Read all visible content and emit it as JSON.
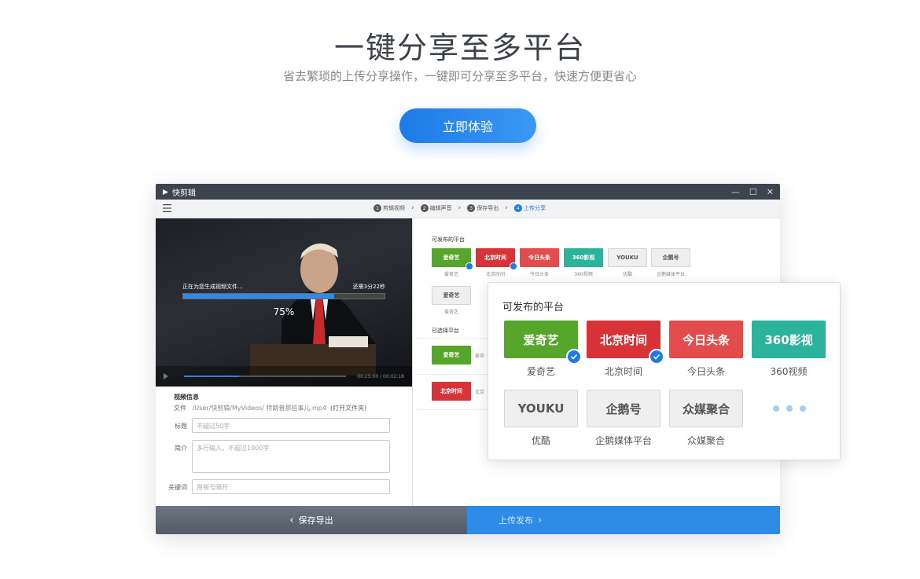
{
  "hero": {
    "title": "一键分享至多平台",
    "subtitle": "省去繁琐的上传分享操作，一键即可分享至多平台，快速方便更省心",
    "cta_label": "立即体验"
  },
  "window": {
    "app_name": "快剪辑",
    "controls": [
      "—",
      "☐",
      "✕"
    ]
  },
  "steps": [
    {
      "num": "1",
      "label": "剪辑视频",
      "active": false
    },
    {
      "num": "2",
      "label": "编辑声音",
      "active": false
    },
    {
      "num": "3",
      "label": "保存导出",
      "active": false
    },
    {
      "num": "4",
      "label": "上传分享",
      "active": true
    }
  ],
  "video": {
    "status_text": "正在为您生成视频文件...",
    "remaining_text": "还需3分22秒",
    "progress_percent": 75,
    "progress_label": "75%",
    "time": "00:25:00 / 00:02:18"
  },
  "form": {
    "heading": "视频信息",
    "file_label": "文件",
    "file_path": "/User/快剪辑/MyVideos/ 特朗普那些事儿.mp4",
    "open_folder": "(打开文件夹)",
    "title_label": "标题",
    "title_placeholder": "不超过50字",
    "intro_label": "简介",
    "intro_placeholder": "多行输入，不超过1000字",
    "keywords_label": "关键词",
    "keywords_placeholder": "用顿号隔开"
  },
  "right_panel": {
    "available_heading": "可发布的平台",
    "selected_heading": "已选择平台",
    "small_platforms": [
      {
        "logo": "爱奇艺",
        "label": "爱奇艺",
        "checked": true
      },
      {
        "logo": "北京时间",
        "label": "北京时间",
        "checked": true
      },
      {
        "logo": "今日头条",
        "label": "今日头条",
        "checked": false
      },
      {
        "logo": "360影视",
        "label": "360视频",
        "checked": false
      },
      {
        "logo": "YOUKU",
        "label": "优酷",
        "checked": false
      },
      {
        "logo": "企鹅号",
        "label": "企鹅媒体平台",
        "checked": false
      },
      {
        "logo": "爱奇艺",
        "label": "爱奇艺",
        "checked": false
      }
    ],
    "selected_platforms": [
      {
        "logo": "爱奇艺",
        "label": "爱奇"
      },
      {
        "logo": "北京时间",
        "label": "北京"
      }
    ]
  },
  "bottom": {
    "back_label": "保存导出",
    "next_label": "上传发布"
  },
  "popup": {
    "title": "可发布的平台",
    "platforms": [
      {
        "logo": "爱奇艺",
        "label": "爱奇艺",
        "checked": true
      },
      {
        "logo": "北京时间",
        "label": "北京时间",
        "checked": true
      },
      {
        "logo": "今日头条",
        "label": "今日头条",
        "checked": false
      },
      {
        "logo": "360影视",
        "label": "360视频",
        "checked": false
      },
      {
        "logo": "YOUKU",
        "label": "优酷",
        "checked": false
      },
      {
        "logo": "企鹅号",
        "label": "企鹅媒体平台",
        "checked": false
      },
      {
        "logo": "众媒聚合",
        "label": "众媒聚合",
        "checked": false
      }
    ]
  },
  "colors": {
    "accent": "#1e7ae6",
    "iqiyi": "#55a62b",
    "bjtime": "#d9333a",
    "toutiao": "#e24c4c",
    "v360": "#2bb39b"
  }
}
